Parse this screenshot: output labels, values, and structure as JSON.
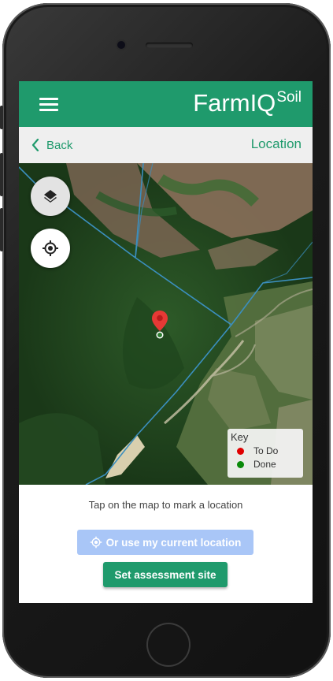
{
  "app": {
    "brand_main": "FarmIQ",
    "brand_sup": "Soil"
  },
  "nav": {
    "back_label": "Back",
    "page_title": "Location"
  },
  "map": {
    "key_title": "Key",
    "legend": [
      {
        "label": "To Do",
        "color": "#e00000"
      },
      {
        "label": "Done",
        "color": "#0a8a0a"
      }
    ]
  },
  "bottom": {
    "hint": "Tap on the map to mark a location",
    "current_location_label": "Or use my current location",
    "set_site_label": "Set assessment site"
  },
  "colors": {
    "brand_green": "#1f9a6c",
    "button_disabled_blue": "#a9c6f7",
    "pin_red": "#e53935"
  },
  "icons": {
    "menu": "hamburger-icon",
    "back": "chevron-left-icon",
    "layers": "layers-icon",
    "locate": "crosshair-icon",
    "pin": "map-pin-icon"
  }
}
